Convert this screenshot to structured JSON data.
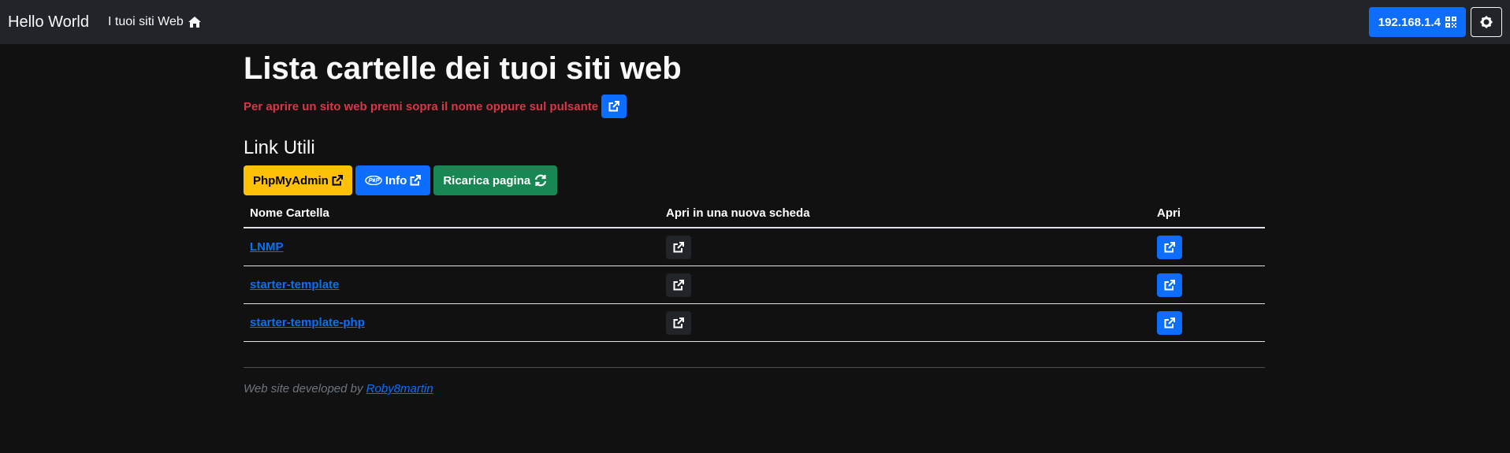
{
  "navbar": {
    "brand": "Hello World",
    "link_label": "I tuoi siti Web",
    "ip_label": "192.168.1.4"
  },
  "main": {
    "title": "Lista cartelle dei tuoi siti web",
    "hint": "Per aprire un sito web premi sopra il nome oppure sul pulsante",
    "links_title": "Link Utili",
    "links": [
      {
        "label": "PhpMyAdmin"
      },
      {
        "label": "Info"
      },
      {
        "label": "Ricarica pagina"
      }
    ]
  },
  "table": {
    "headers": [
      "Nome Cartella",
      "Apri in una nuova scheda",
      "Apri"
    ],
    "rows": [
      {
        "name": "LNMP"
      },
      {
        "name": "starter-template"
      },
      {
        "name": "starter-template-php"
      }
    ]
  },
  "footer": {
    "prefix": "Web site developed by",
    "author": "Roby8martin"
  },
  "colors": {
    "primary": "#0d6efd",
    "warning": "#ffc107",
    "success": "#198754",
    "danger": "#dc3545",
    "navbar": "#212529",
    "background": "#111111"
  }
}
